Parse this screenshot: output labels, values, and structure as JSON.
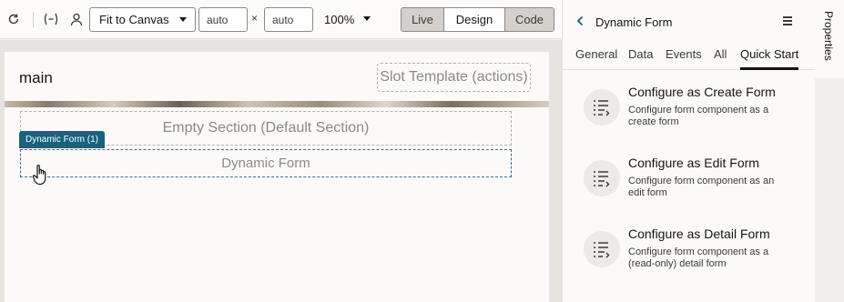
{
  "toolbar": {
    "fit_select": "Fit to Canvas",
    "width_value": "auto",
    "height_value": "auto",
    "times": "×",
    "zoom": "100%",
    "modes": [
      "Live",
      "Design",
      "Code"
    ]
  },
  "canvas": {
    "page_title": "main",
    "slot_template": "Slot Template (actions)",
    "empty_section": "Empty Section (Default Section)",
    "dynamic_form_label": "Dynamic Form",
    "badge": "Dynamic Form (1)"
  },
  "panel": {
    "title": "Dynamic Form",
    "tabs": [
      "General",
      "Data",
      "Events",
      "All",
      "Quick Start"
    ],
    "active_tab": "Quick Start",
    "quick_start": [
      {
        "title": "Configure as Create Form",
        "desc": "Configure form component as a create form"
      },
      {
        "title": "Configure as Edit Form",
        "desc": "Configure form component as an edit form"
      },
      {
        "title": "Configure as Detail Form",
        "desc": "Configure form component as a (read-only) detail form"
      }
    ]
  },
  "side_tab": {
    "label": "Properties"
  }
}
